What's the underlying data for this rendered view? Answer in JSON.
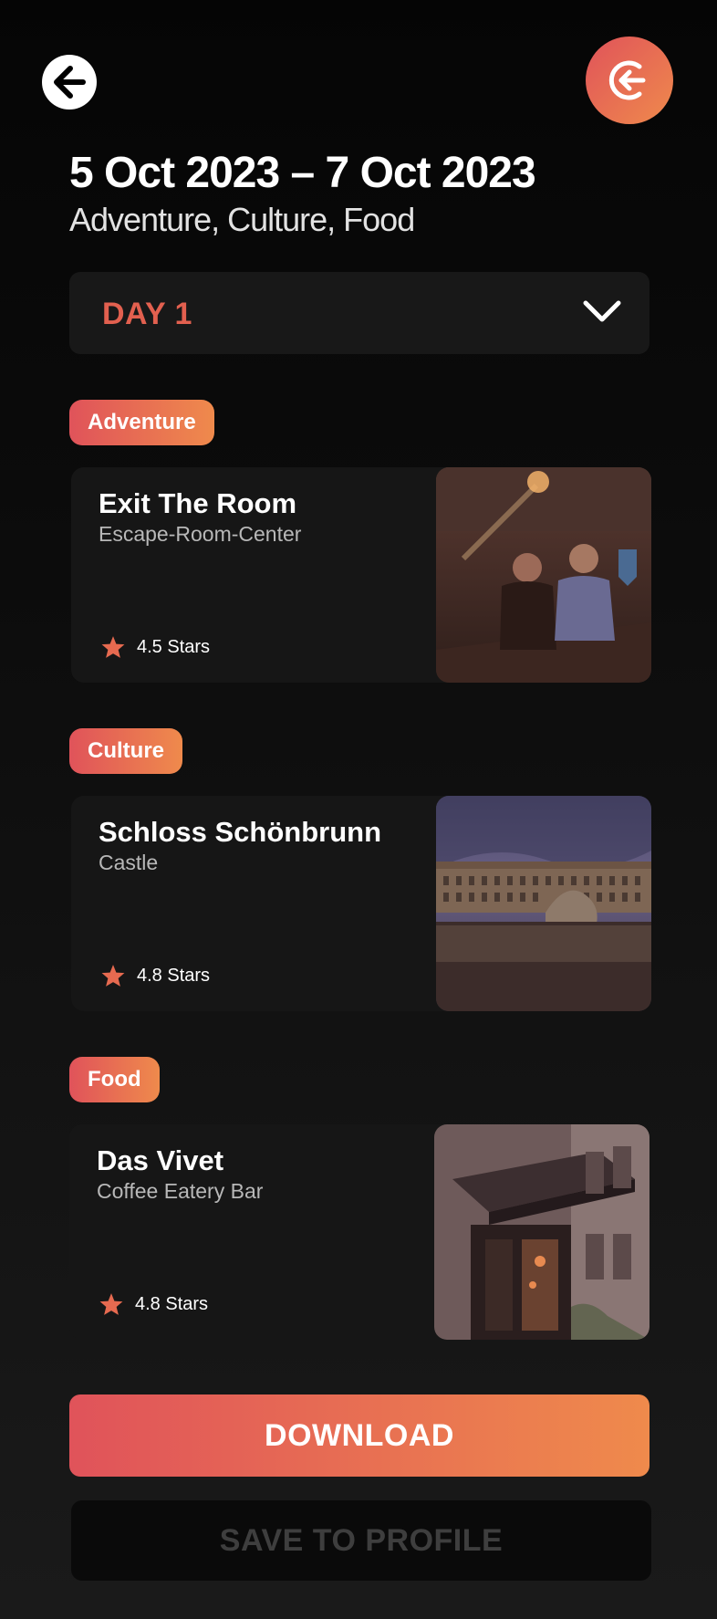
{
  "header": {
    "back_icon": "arrow-left-icon",
    "logout_icon": "logout-icon"
  },
  "trip": {
    "date_range": "5 Oct 2023 – 7 Oct 2023",
    "interests": "Adventure, Culture, Food"
  },
  "day_selector": {
    "label": "DAY 1",
    "icon": "chevron-down-icon"
  },
  "sections": [
    {
      "tag": "Adventure",
      "title": "Exit The Room",
      "subtitle": "Escape-Room-Center",
      "rating": "4.5 Stars"
    },
    {
      "tag": "Culture",
      "title": "Schloss Schönbrunn",
      "subtitle": "Castle",
      "rating": "4.8 Stars"
    },
    {
      "tag": "Food",
      "title": "Das Vivet",
      "subtitle": "Coffee Eatery Bar",
      "rating": "4.8 Stars"
    }
  ],
  "actions": {
    "download": "DOWNLOAD",
    "save": "SAVE TO PROFILE"
  },
  "colors": {
    "accent_start": "#e0535a",
    "accent_end": "#ef8a4c",
    "background": "#0d0d0d",
    "card": "#161616"
  }
}
